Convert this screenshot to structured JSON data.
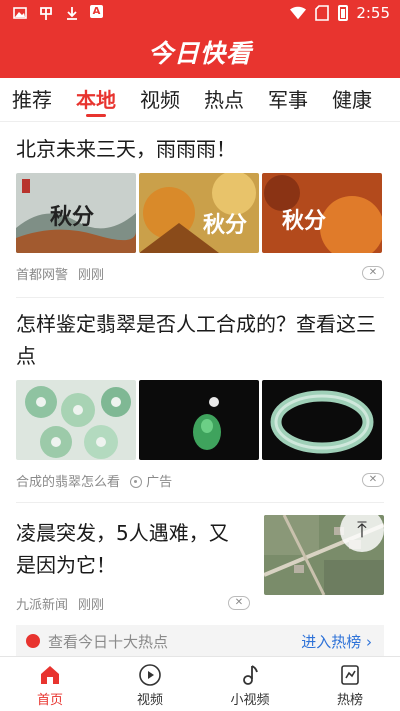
{
  "status_bar": {
    "time": "2:55",
    "left_icons": [
      "image-icon",
      "xiaohongshu-icon",
      "download-icon",
      "a-icon"
    ],
    "right_icons": [
      "wifi-icon",
      "sim-icon",
      "battery-icon"
    ]
  },
  "header": {
    "app_title": "今日快看"
  },
  "tabs": [
    "推荐",
    "本地",
    "视频",
    "热点",
    "军事",
    "健康"
  ],
  "active_tab": 1,
  "feed": [
    {
      "title": "北京未来三天，雨雨雨！",
      "images": [
        "autumn-image",
        "autumn-image",
        "autumn-image"
      ],
      "image_captions": [
        "秋分",
        "秋分",
        "秋分"
      ],
      "source": "首都网警",
      "time": "刚刚"
    },
    {
      "title": "怎样鉴定翡翠是否人工合成的？查看这三点",
      "images": [
        "jade-beads-image",
        "jade-pendant-image",
        "jade-bangle-image"
      ],
      "source": "合成的翡翠怎么看",
      "badge": "广告"
    },
    {
      "title": "凌晨突发，5人遇难，又是因为它！",
      "images": [
        "aerial-map-image"
      ],
      "source": "九派新闻",
      "time": "刚刚"
    }
  ],
  "hot_bar": {
    "text": "查看今日十大热点",
    "link": "进入热榜",
    "link_arrow": "›"
  },
  "bottom_nav": [
    {
      "label": "首页",
      "icon": "home-icon"
    },
    {
      "label": "视频",
      "icon": "play-icon"
    },
    {
      "label": "小视频",
      "icon": "music-note-icon"
    },
    {
      "label": "热榜",
      "icon": "chart-icon"
    }
  ],
  "active_nav": 0,
  "colors": {
    "brand": "#e8342f",
    "link": "#2f73d8",
    "meta": "#8a8a8a"
  },
  "scroll_top_glyph": "⤒",
  "close_glyph": "✕"
}
